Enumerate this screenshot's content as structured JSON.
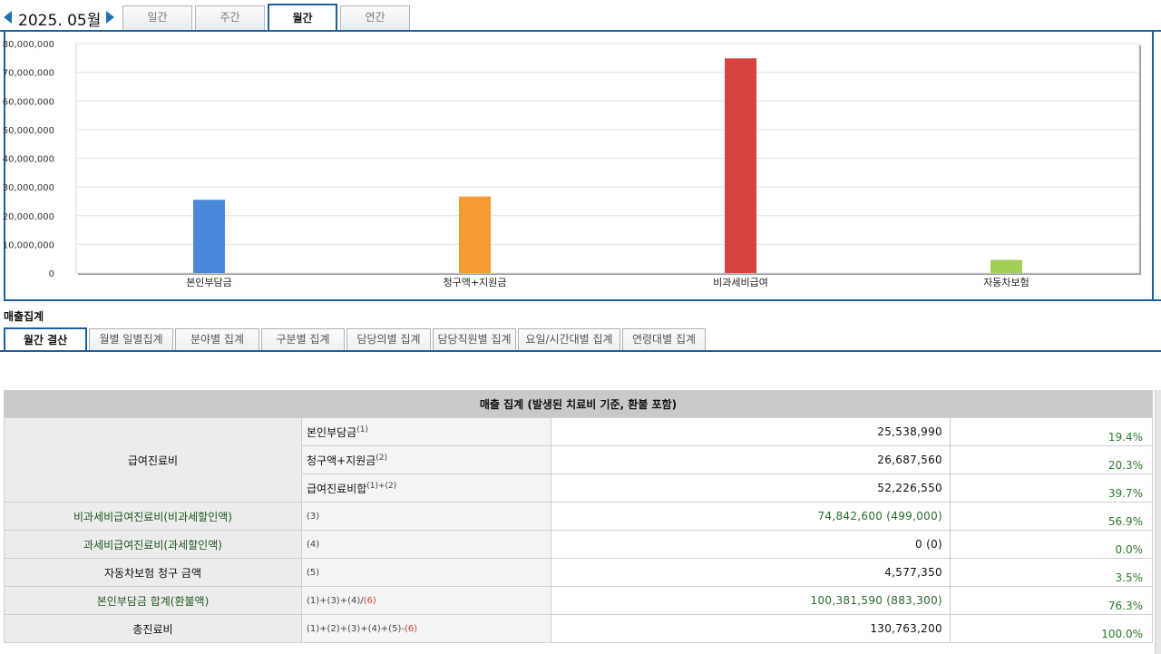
{
  "header": {
    "month_label": "2025. 05월",
    "period_tabs": [
      "일간",
      "주간",
      "월간",
      "연간"
    ],
    "active_period": "월간"
  },
  "chart_data": {
    "type": "bar",
    "categories": [
      "본인부담금",
      "청구액+지원금",
      "비과세비급여",
      "자동차보험"
    ],
    "values": [
      25538990,
      26687560,
      74842600,
      4577350
    ],
    "colors": [
      "#4a88d8",
      "#f79a32",
      "#d9433e",
      "#a3cf57"
    ],
    "y_ticks": [
      "80,000,000",
      "70,000,000",
      "60,000,000",
      "50,000,000",
      "40,000,000",
      "30,000,000",
      "20,000,000",
      "10,000,000",
      "0"
    ],
    "ylim": [
      0,
      80000000
    ],
    "grid": true,
    "legend": "none"
  },
  "section_title": "매출집계",
  "sub_tabs": [
    "월간 결산",
    "월별 일별집계",
    "분야별 집계",
    "구분별 집계",
    "담당의별 집계",
    "담당직원별 집계",
    "요일/시간대별 집계",
    "연령대별 집계"
  ],
  "active_sub_tab": "월간 결산",
  "table": {
    "header": "매출 집계 (발생된 치료비 기준, 환불 포함)",
    "group_label": "급여진료비",
    "rows": [
      {
        "label": "급여진료비",
        "sub": "본인부담금",
        "sub_ref": "(1)",
        "value": "25,538,990",
        "pct": "19.4%"
      },
      {
        "label": "급여진료비",
        "sub": "청구액+지원금",
        "sub_ref": "(2)",
        "value": "26,687,560",
        "pct": "20.3%"
      },
      {
        "label": "급여진료비",
        "sub": "급여진료비합",
        "sub_ref": "(1)+(2)",
        "value": "52,226,550",
        "pct": "39.7%"
      },
      {
        "label": "비과세비급여진료비(비과세할인액)",
        "sub_ref": "(3)",
        "value": "74,842,600 (499,000)",
        "pct": "56.9%"
      },
      {
        "label": "과세비급여진료비(과세할인액)",
        "sub_ref": "(4)",
        "value": "0 (0)",
        "pct": "0.0%"
      },
      {
        "label": "자동차보험 청구 금액",
        "sub_ref": "(5)",
        "value": "4,577,350",
        "pct": "3.5%"
      },
      {
        "label": "본인부담금 합계(환불액)",
        "sub_ref": "(1)+(3)+(4)/",
        "sub_ref_red": "(6)",
        "value": "100,381,590 (883,300)",
        "pct": "76.3%"
      },
      {
        "label": "총진료비",
        "sub_ref": "(1)+(2)+(3)+(4)+(5)-",
        "sub_ref_red": "(6)",
        "value": "130,763,200",
        "pct": "100.0%"
      }
    ]
  }
}
